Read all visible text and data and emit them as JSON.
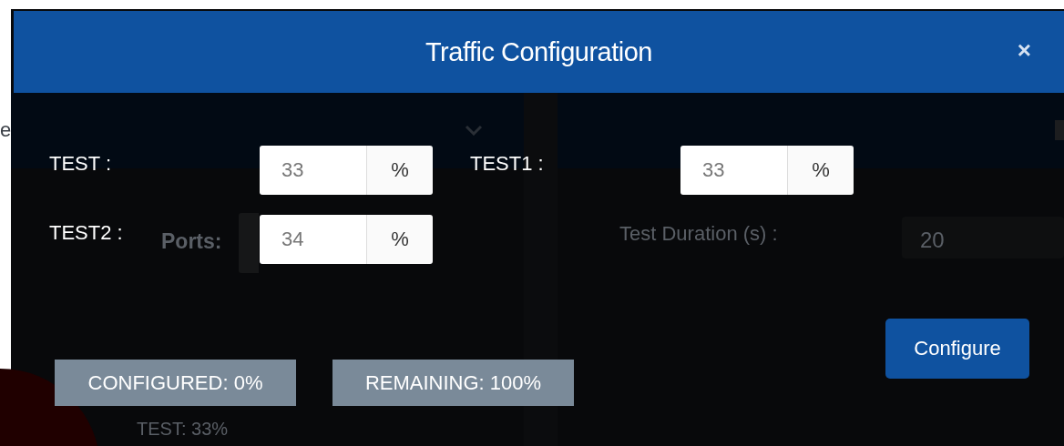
{
  "backdrop": {
    "edge_text": "e",
    "ports_label": "Ports:",
    "duration_label": "Test Duration (s) :",
    "duration_value": "20",
    "legend_item": "TEST: 33%"
  },
  "modal": {
    "title": "Traffic Configuration",
    "close": "×",
    "fields": [
      {
        "label": "TEST :",
        "value": "33",
        "unit": "%"
      },
      {
        "label": "TEST1 :",
        "value": "33",
        "unit": "%"
      },
      {
        "label": "TEST2 :",
        "value": "34",
        "unit": "%"
      }
    ],
    "badges": [
      "CONFIGURED: 0%",
      "REMAINING: 100%"
    ],
    "button": "Configure"
  }
}
